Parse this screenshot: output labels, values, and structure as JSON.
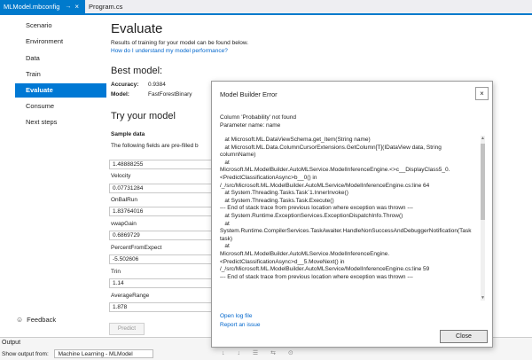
{
  "tabs": {
    "active": {
      "title": "MLModel.mbconfig",
      "pin": "→",
      "close": "×"
    },
    "inactive": {
      "title": "Program.cs"
    }
  },
  "sidebar": {
    "items": [
      {
        "label": "Scenario"
      },
      {
        "label": "Environment"
      },
      {
        "label": "Data"
      },
      {
        "label": "Train"
      },
      {
        "label": "Evaluate"
      },
      {
        "label": "Consume"
      },
      {
        "label": "Next steps"
      }
    ],
    "feedback_label": "Feedback",
    "feedback_icon": "☺"
  },
  "main": {
    "heading": "Evaluate",
    "intro": "Results of training for your model can be found below.",
    "intro_link": "How do I understand my model performance?",
    "best_model_heading": "Best model:",
    "accuracy_label": "Accuracy:",
    "accuracy_value": "0.9384",
    "model_label": "Model:",
    "model_value": "FastForestBinary",
    "try_heading": "Try your model",
    "sample_heading": "Sample data",
    "prefilled_text": "The following fields are pre-filled b",
    "fields": [
      {
        "label": "",
        "value": "1.48888255"
      },
      {
        "label": "Velocity",
        "value": "0.07731284"
      },
      {
        "label": "OnBalRun",
        "value": "1.83764016"
      },
      {
        "label": "vwapGain",
        "value": "0.6869729"
      },
      {
        "label": "PercentFromExpect",
        "value": "-5.502606"
      },
      {
        "label": "Trin",
        "value": "1.14"
      },
      {
        "label": "AverageRange",
        "value": "1.878"
      }
    ],
    "predict_label": "Predict"
  },
  "output": {
    "title": "Output",
    "show_from_label": "Show output from:",
    "source_value": "Machine Learning - MLModel",
    "tool_icons": "↓ ↓ ☰ ⇆ ⊙"
  },
  "dialog": {
    "title": "Model Builder Error",
    "close_icon": "×",
    "message_line1": "Column 'Probability' not found",
    "message_line2": "Parameter name: name",
    "trace": "   at Microsoft.ML.DataViewSchema.get_Item(String name)\n   at Microsoft.ML.Data.ColumnCursorExtensions.GetColumn[T](IDataView data, String columnName)\n   at\nMicrosoft.ML.ModelBuilder.AutoMLService.ModelInferenceEngine.<>c__DisplayClass5_0.<PredictClassificationAsync>b__0() in /_/src/Microsoft.ML.ModelBuilder.AutoMLService/ModelInferenceEngine.cs:line 64\n   at System.Threading.Tasks.Task`1.InnerInvoke()\n   at System.Threading.Tasks.Task.Execute()\n--- End of stack trace from previous location where exception was thrown ---\n   at System.Runtime.ExceptionServices.ExceptionDispatchInfo.Throw()\n   at\nSystem.Runtime.CompilerServices.TaskAwaiter.HandleNonSuccessAndDebuggerNotification(Task task)\n   at\nMicrosoft.ML.ModelBuilder.AutoMLService.ModelInferenceEngine.<PredictClassificationAsync>d__5.MoveNext() in /_/src/Microsoft.ML.ModelBuilder.AutoMLService/ModelInferenceEngine.cs:line 59\n--- End of stack trace from previous location where exception was thrown ---",
    "open_log_link": "Open log file",
    "report_link": "Report an issue",
    "close_button": "Close"
  },
  "colors": {
    "accent": "#007acc",
    "selected_nav": "#0078d4",
    "link": "#0066cc"
  }
}
